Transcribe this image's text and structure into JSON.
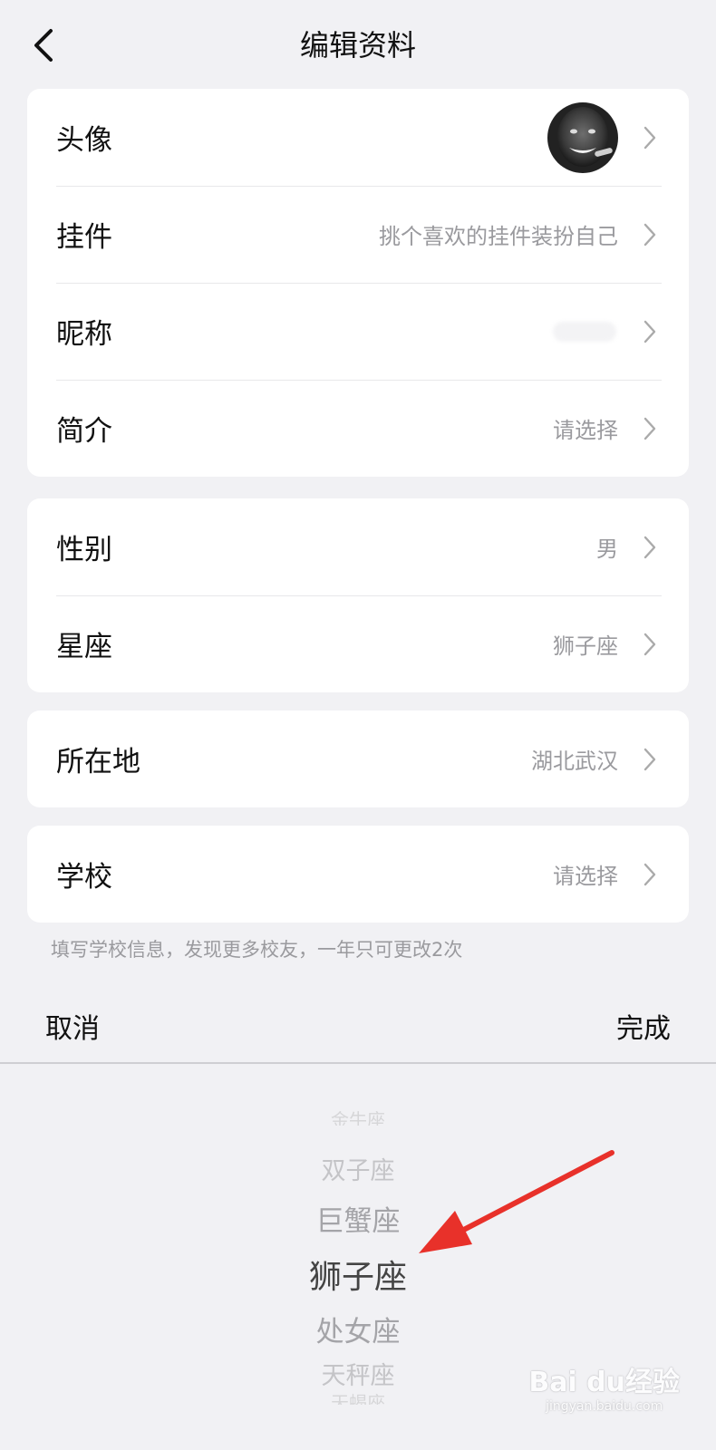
{
  "header": {
    "title": "编辑资料"
  },
  "groups": [
    [
      {
        "label": "头像",
        "value": "",
        "type": "avatar"
      },
      {
        "label": "挂件",
        "value": "挑个喜欢的挂件装扮自己"
      },
      {
        "label": "昵称",
        "value": "",
        "type": "blurred"
      },
      {
        "label": "简介",
        "value": "请选择"
      }
    ],
    [
      {
        "label": "性别",
        "value": "男"
      },
      {
        "label": "星座",
        "value": "狮子座"
      }
    ],
    [
      {
        "label": "所在地",
        "value": "湖北武汉"
      }
    ],
    [
      {
        "label": "学校",
        "value": "请选择"
      }
    ]
  ],
  "hint": "填写学校信息，发现更多校友，一年只可更改2次",
  "picker": {
    "cancel": "取消",
    "done": "完成",
    "options": [
      "金牛座",
      "双子座",
      "巨蟹座",
      "狮子座",
      "处女座",
      "天秤座",
      "天蝎座"
    ],
    "selected": "狮子座"
  },
  "watermark": {
    "brand": "Bai du经验",
    "url": "jingyan.baidu.com"
  },
  "colors": {
    "arrow": "#e8312a",
    "background": "#f1f1f4"
  }
}
